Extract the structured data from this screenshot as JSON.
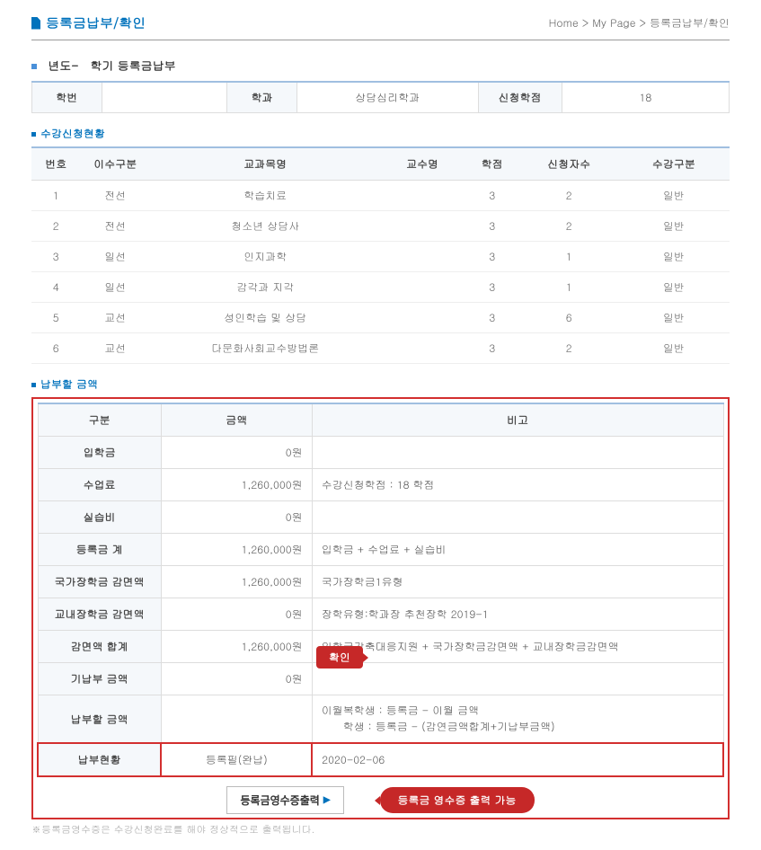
{
  "header": {
    "title": "등록금납부/확인",
    "breadcrumb": "Home > My Page > 등록금납부/확인"
  },
  "term": {
    "label": "년도-　학기 등록금납부"
  },
  "student_info": {
    "id_label": "학번",
    "id_value": "",
    "dept_label": "학과",
    "dept_value": "상담심리학과",
    "credit_label": "신청학점",
    "credit_value": "18"
  },
  "course_section_title": "수강신청현황",
  "course_headers": {
    "no": "번호",
    "type": "이수구분",
    "name": "교과목명",
    "prof": "교수명",
    "credit": "학점",
    "applicants": "신청자수",
    "category": "수강구분"
  },
  "courses": [
    {
      "no": "1",
      "type": "전선",
      "name": "학습치료",
      "prof": "",
      "credit": "3",
      "applicants": "2",
      "category": "일반"
    },
    {
      "no": "2",
      "type": "전선",
      "name": "청소년 상담사",
      "prof": "",
      "credit": "3",
      "applicants": "2",
      "category": "일반"
    },
    {
      "no": "3",
      "type": "일선",
      "name": "인지과학",
      "prof": "",
      "credit": "3",
      "applicants": "1",
      "category": "일반"
    },
    {
      "no": "4",
      "type": "일선",
      "name": "감각과 지각",
      "prof": "",
      "credit": "3",
      "applicants": "1",
      "category": "일반"
    },
    {
      "no": "5",
      "type": "교선",
      "name": "성인학습 및 상담",
      "prof": "",
      "credit": "3",
      "applicants": "6",
      "category": "일반"
    },
    {
      "no": "6",
      "type": "교선",
      "name": "다문화사회교수방법론",
      "prof": "",
      "credit": "3",
      "applicants": "2",
      "category": "일반"
    }
  ],
  "payment_section_title": "납부할 금액",
  "payment_headers": {
    "category": "구분",
    "amount": "금액",
    "remark": "비고"
  },
  "payments": [
    {
      "label": "입학금",
      "amount": "0원",
      "remark": ""
    },
    {
      "label": "수업료",
      "amount": "1,260,000원",
      "remark": "수강신청학점 : 18 학점"
    },
    {
      "label": "실습비",
      "amount": "0원",
      "remark": ""
    },
    {
      "label": "등록금 계",
      "amount": "1,260,000원",
      "remark": "입학금 + 수업료 + 실습비"
    },
    {
      "label": "국가장학금 감면액",
      "amount": "1,260,000원",
      "remark": "국가장학금1유형"
    },
    {
      "label": "교내장학금 감면액",
      "amount": "0원",
      "remark": "장학유형:학과장 추천장학 2019-1"
    },
    {
      "label": "감면액 합계",
      "amount": "1,260,000원",
      "remark": "입학금감축대응지원 + 국가장학금감면액 + 교내장학금감면액"
    },
    {
      "label": "기납부 금액",
      "amount": "0원",
      "remark": ""
    },
    {
      "label": "납부할 금액",
      "amount": "",
      "remark": "이월복학생 : 등록금 - 이월 금액\n　　학생 : 등록금 - (감연금액합계+기납부금액)"
    }
  ],
  "status": {
    "label": "납부현황",
    "value": "등록필(완납)",
    "date": "2020-02-06"
  },
  "confirm_badge": "확인",
  "print_button": "등록금영수증출력",
  "banner_text": "등록금 영수증 출력 가능",
  "footnote": "※등록금영수증은 수강신청완료를 해야 정상적으로 출력됩니다."
}
